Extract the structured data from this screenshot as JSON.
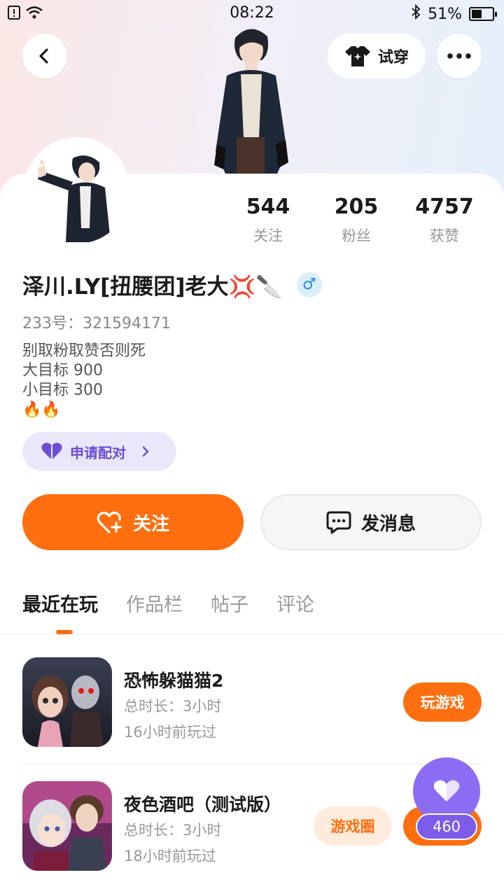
{
  "status_bar": {
    "time": "08:22",
    "battery": "51%",
    "battery_level": 0.51
  },
  "header": {
    "try_on_label": "试穿"
  },
  "profile": {
    "stats": [
      {
        "value": "544",
        "label": "关注"
      },
      {
        "value": "205",
        "label": "粉丝"
      },
      {
        "value": "4757",
        "label": "获赞"
      }
    ],
    "name": "泽川.LY[扭腰团]老大💢🔪",
    "gender_symbol": "♂",
    "uid": "233号：321594171",
    "bio_lines": [
      "别取粉取赞否则死",
      "大目标 900",
      "小目标  300",
      "🔥🔥"
    ],
    "pair_label": "申请配对"
  },
  "actions": {
    "follow_label": "关注",
    "message_label": "发消息"
  },
  "tabs": [
    "最近在玩",
    "作品栏",
    "帖子",
    "评论"
  ],
  "games": [
    {
      "title": "恐怖躲猫猫2",
      "duration": "总时长：3小时",
      "last_played": "16小时前玩过",
      "play_label": "玩游戏"
    },
    {
      "title": "夜色酒吧（测试版）",
      "duration": "总时长：3小时",
      "last_played": "18小时前玩过",
      "circle_label": "游戏圈",
      "play_label": "玩游戏"
    }
  ],
  "like_fab": {
    "count": "460"
  },
  "colors": {
    "accent": "#ff6f0f",
    "purple": "#8c6cf3"
  }
}
